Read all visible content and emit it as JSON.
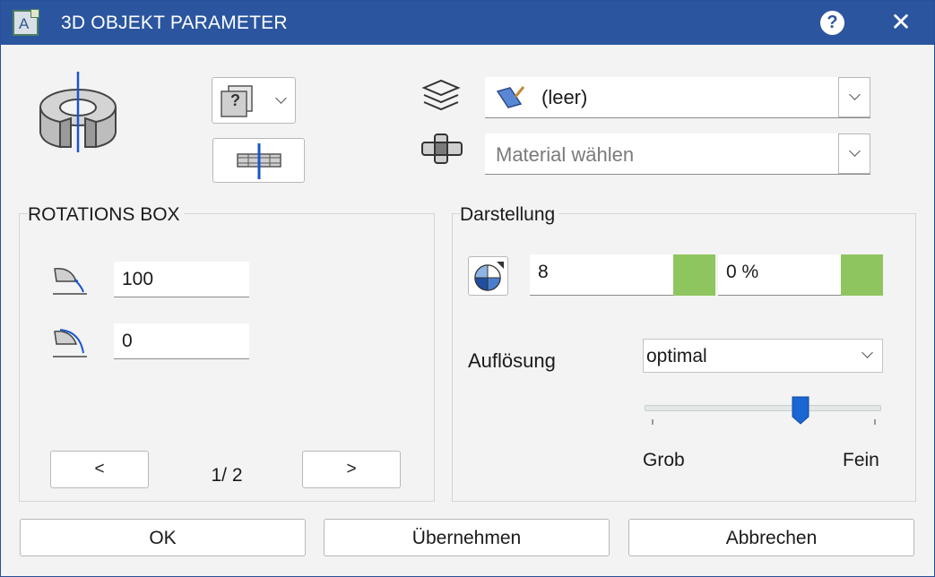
{
  "window": {
    "title": "3D OBJEKT PARAMETER",
    "app_icon_letter": "A",
    "help_symbol": "?",
    "close_symbol": "✕"
  },
  "top": {
    "type_selector": {
      "icon_glyph": "?"
    },
    "layer": {
      "value": "(leer)"
    },
    "material": {
      "placeholder": "Material wählen"
    }
  },
  "rotation_box": {
    "title": "ROTATIONS BOX",
    "fields": [
      {
        "value": "100"
      },
      {
        "value": "0"
      }
    ],
    "pager": {
      "prev_label": "<",
      "next_label": ">",
      "page_text": "1/ 2"
    }
  },
  "display": {
    "title": "Darstellung",
    "segments_value": "8",
    "transparency_value": "0 %",
    "resolution_label": "Auflösung",
    "resolution_value": "optimal",
    "slider": {
      "level": 0.66,
      "min_label": "Grob",
      "max_label": "Fein"
    },
    "swatch_color": "#8fc55f"
  },
  "footer": {
    "ok_label": "OK",
    "apply_label": "Übernehmen",
    "cancel_label": "Abbrechen"
  },
  "colors": {
    "titlebar": "#2b569f",
    "accent_blue": "#1a66d2",
    "swatch": "#8fc55f"
  }
}
